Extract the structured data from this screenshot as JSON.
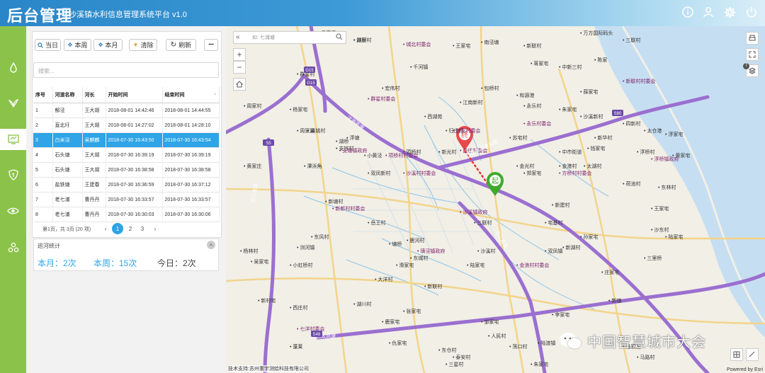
{
  "header": {
    "title": "后台管理",
    "subtitle": "沙溪镇水利信息管理系统平台 v1.0"
  },
  "toolbar": {
    "today": "当日",
    "week": "本周",
    "month": "本月",
    "clear": "清除",
    "refresh": "刷新",
    "more": "•••"
  },
  "search": {
    "placeholder": "搜索..."
  },
  "table": {
    "headers": [
      "序号",
      "河道名称",
      "河长",
      "开始时间",
      "结束时间"
    ],
    "rows": [
      {
        "no": "1",
        "river": "郁泾",
        "chief": "王大胡",
        "start": "2018-08-01 14:42:46",
        "end": "2018-08-01 14:44:55"
      },
      {
        "no": "2",
        "river": "直北圩",
        "chief": "王大胡",
        "start": "2018-08-01 14:27:02",
        "end": "2018-08-01 14:28:10"
      },
      {
        "no": "3",
        "river": "白米泾",
        "chief": "吴麒麟",
        "start": "2018-07-30 16:43:50",
        "end": "2018-07-30 16:43:54"
      },
      {
        "no": "4",
        "river": "石头塘",
        "chief": "王大胡",
        "start": "2018-07-30 16:39:19",
        "end": "2018-07-30 16:39:19"
      },
      {
        "no": "5",
        "river": "石头塘",
        "chief": "王大胡",
        "start": "2018-07-30 16:38:58",
        "end": "2018-07-30 16:38:58"
      },
      {
        "no": "6",
        "river": "盐铁塘",
        "chief": "王建春",
        "start": "2018-07-30 16:36:59",
        "end": "2018-07-30 16:37:12"
      },
      {
        "no": "7",
        "river": "老七浦",
        "chief": "曹丹丹",
        "start": "2018-07-30 16:33:57",
        "end": "2018-07-30 16:33:57"
      },
      {
        "no": "8",
        "river": "老七浦",
        "chief": "曹丹丹",
        "start": "2018-07-30 16:30:03",
        "end": "2018-07-30 16:30:06"
      }
    ],
    "selected_index": 2
  },
  "pager": {
    "summary": "第1页，共 3页 (20 项)",
    "pages": [
      "1",
      "2",
      "3"
    ],
    "current": "1"
  },
  "stats": {
    "title": "巡河统计",
    "month": "本月：2次",
    "week": "本周：15次",
    "today": "今日：2次"
  },
  "map": {
    "search_placeholder": "如: 七浦塘",
    "layer_count": "7",
    "attribution": "技术支持:苏州重宇测绘科技有限公司",
    "esri": "Powered by Esri",
    "watermark": "中国智慧城市大会",
    "marker_start": "起",
    "marker_end": "终",
    "highway_labels": [
      "沈海高速",
      "苏昆太高速",
      "沿江高速",
      "苏昆太高速公路",
      "沿江高速"
    ],
    "road_shields": [
      "G15",
      "S5",
      "S80",
      "G15",
      "S48"
    ],
    "places": [
      "毛家湾",
      "顾家",
      "城北村委会",
      "王家宅",
      "南泾塘",
      "新联村",
      "万方国际码头",
      "三联村",
      "蒋家宅",
      "陈家",
      "中新三村",
      "新联村村委会",
      "薛家宅",
      "群星村",
      "千河镇",
      "群星村委会",
      "包桥村",
      "永乐村",
      "朱家宅",
      "周家村",
      "杨家宅",
      "宏伟村",
      "永乐村委会",
      "沙溪新村",
      "新华村",
      "周家路",
      "西湖苑",
      "归庄村",
      "苏宅村",
      "江南新村",
      "刘家村委会",
      "和源港",
      "四新村",
      "太仓港",
      "浮家宅",
      "黄家宅",
      "吴姚村",
      "浮塘",
      "湖桥",
      "支钱村",
      "支塘镇政府",
      "小黄泾",
      "项桥村村委会",
      "项桥村",
      "白庄村委会",
      "新光村",
      "中市街道",
      "钱家宅",
      "浮桥村",
      "浮桥镇政府",
      "黄家庄",
      "潭浜角",
      "金光村",
      "金港村",
      "郑家宅",
      "太湖村",
      "方桥村村委会",
      "荷池村",
      "东林村",
      "沙溪村村委会",
      "双凤新村",
      "沙溪镇政府",
      "新建村",
      "王家宅",
      "新郎村村委会",
      "新塘村",
      "陆家宅",
      "三联村",
      "宅基村",
      "沙东村",
      "岳王村",
      "鹿河村",
      "璜泾镇政府",
      "杨林村",
      "吴家宅",
      "小虹桥村",
      "沙溪村",
      "孙家宅",
      "双凤镇",
      "新湖村",
      "金浪村村委会",
      "东风村",
      "浏河镇",
      "塘桥",
      "东城村",
      "三里桥",
      "陆家宅",
      "庄家宅",
      "新联村",
      "西庄村",
      "七洋村委会",
      "蓬莱",
      "湖川村",
      "大洋村",
      "滑家宅",
      "鹿家宅",
      "张家宅",
      "李家宅",
      "新塘",
      "邹家宅",
      "人民村",
      "陆渡镇",
      "荡口村",
      "东仓村",
      "仇家宅",
      "泰安村",
      "三星村",
      "朱家宅",
      "陆家庄",
      "马路村",
      "新村宅",
      "马家宅",
      "湖桥村"
    ]
  }
}
